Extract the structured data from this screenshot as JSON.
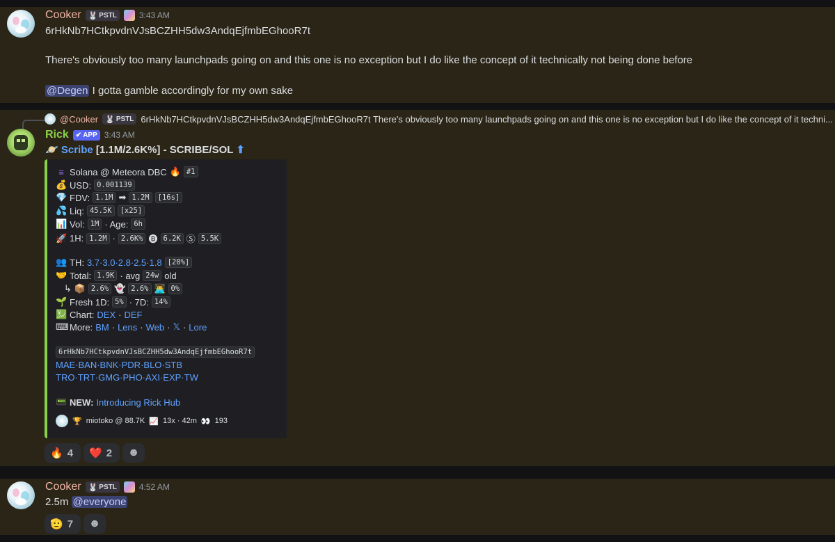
{
  "messages": [
    {
      "author": "Cooker",
      "author_color": "#f0b4a8",
      "role_tag": "PSTL",
      "role_icon": "bunny-icon",
      "time": "3:43 AM",
      "lines": [
        "6rHkNb7HCtkpvdnVJsBCZHH5dw3AndqEjfmbEGhooR7t",
        "There's obviously too many launchpads going on and this one is no exception but I do like the concept of it technically not being done before"
      ],
      "mention": "@Degen",
      "mention_text": "I gotta gamble accordingly for my own sake"
    },
    {
      "reply": {
        "author": "@Cooker",
        "role_tag": "PSTL",
        "text": "6rHkNb7HCtkpvdnVJsBCZHH5dw3AndqEjfmbEGhooR7t  There's obviously too many launchpads going on and this one is no exception but I do like the concept of it techni..."
      },
      "author": "Rick",
      "author_color": "#8ad04b",
      "app_tag": "APP",
      "time": "3:43 AM",
      "headline_name": "Scribe",
      "headline_rest": "[1.1M/2.6K%] - SCRIBE/SOL",
      "embed": {
        "line1": "Solana @ Meteora DBC",
        "rank": "#1",
        "usd_label": "USD:",
        "usd": "0.001139",
        "fdv_label": "FDV:",
        "fdv_from": "1.1M",
        "fdv_to": "1.2M",
        "fdv_time": "[16s]",
        "liq_label": "Liq:",
        "liq": "45.5K",
        "liq_x": "[x25]",
        "vol_label": "Vol:",
        "vol": "1M",
        "age_label": "· Age:",
        "age": "6h",
        "h1_label": "1H:",
        "h1_a": "1.2M",
        "h1_b": "2.6K%",
        "h1_c": "6.2K",
        "h1_d": "5.5K",
        "th_label": "TH:",
        "th_values": "3.7·3.0·2.8·2.5·1.8",
        "th_pct": "[20%]",
        "total_label": "Total:",
        "total": "1.9K",
        "avg_label": "· avg",
        "avg": "24w",
        "old_label": "old",
        "sub_a": "2.6%",
        "sub_b": "2.6%",
        "sub_c": "0%",
        "fresh_label": "Fresh 1D:",
        "fresh_1d": "5%",
        "fresh_7d_label": "· 7D:",
        "fresh_7d": "14%",
        "chart_label": "Chart:",
        "chart_dex": "DEX",
        "chart_def": "DEF",
        "more_label": "More:",
        "more_links": [
          "BM",
          "Lens",
          "Web",
          "𝕏",
          "Lore"
        ],
        "address": "6rHkNb7HCtkpvdnVJsBCZHH5dw3AndqEjfmbEGhooR7t",
        "links_row1": "MAE·BAN·BNK·PDR·BLO·STB",
        "links_row2": "TRO·TRT·GMG·PHO·AXI·EXP·TW",
        "new_label": "NEW:",
        "new_link": "Introducing Rick Hub",
        "footer": "miotoko @ 88.7K",
        "footer_b": "13x · 42m",
        "footer_c": "193"
      },
      "reactions": [
        {
          "emoji": "🔥",
          "count": "4"
        },
        {
          "emoji": "❤️",
          "count": "2"
        }
      ]
    },
    {
      "author": "Cooker",
      "author_color": "#f0b4a8",
      "role_tag": "PSTL",
      "time": "4:52 AM",
      "text": "2.5m",
      "mention": "@everyone",
      "reactions": [
        {
          "emoji": "🫡",
          "count": "7"
        }
      ]
    }
  ],
  "colors": {
    "bg": "#1a1a1e",
    "highlight": "#2b2517",
    "link": "#5ea1ff",
    "embed_accent": "#8ad04b"
  }
}
